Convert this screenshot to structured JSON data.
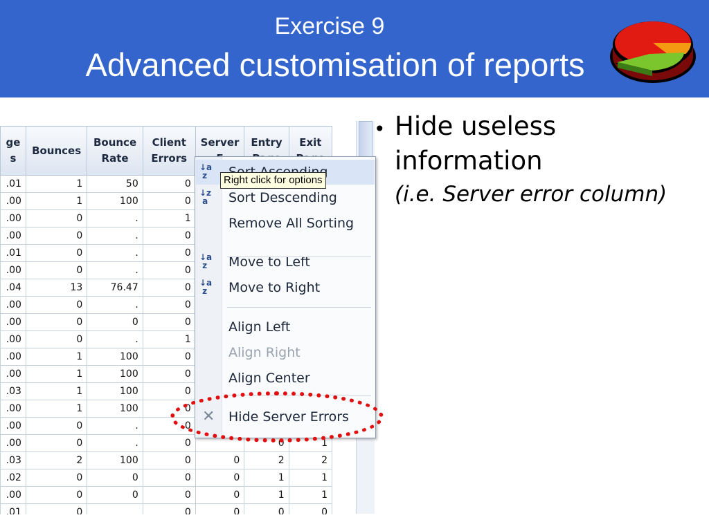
{
  "header": {
    "line1": "Exercise 9",
    "line2": "Advanced customisation of reports",
    "bg_color": "#3465cc",
    "logo_icon": "3d-pie-chart-icon"
  },
  "grid": {
    "columns": [
      {
        "label": "ge\ns"
      },
      {
        "label": "Bounces"
      },
      {
        "label": "Bounce\nRate"
      },
      {
        "label": "Client\nErrors"
      },
      {
        "label": "Server\nE"
      },
      {
        "label": "Entry\nPage"
      },
      {
        "label": "Exit\nPage"
      }
    ],
    "rows": [
      [
        ".01",
        "1",
        "50",
        "0",
        "",
        "",
        ""
      ],
      [
        ".00",
        "1",
        "100",
        "0",
        "",
        "",
        ""
      ],
      [
        ".00",
        "0",
        ".",
        "1",
        "",
        "",
        ""
      ],
      [
        ".00",
        "0",
        ".",
        "0",
        "",
        "",
        ""
      ],
      [
        ".01",
        "0",
        ".",
        "0",
        "",
        "",
        ""
      ],
      [
        ".00",
        "0",
        ".",
        "0",
        "",
        "",
        ""
      ],
      [
        ".04",
        "13",
        "76.47",
        "0",
        "",
        "",
        ""
      ],
      [
        ".00",
        "0",
        ".",
        "0",
        "",
        "",
        ""
      ],
      [
        ".00",
        "0",
        "0",
        "0",
        "",
        "",
        ""
      ],
      [
        ".00",
        "0",
        ".",
        "1",
        "",
        "",
        ""
      ],
      [
        ".00",
        "1",
        "100",
        "0",
        "",
        "",
        ""
      ],
      [
        ".00",
        "1",
        "100",
        "0",
        "",
        "",
        ""
      ],
      [
        ".03",
        "1",
        "100",
        "0",
        "",
        "",
        ""
      ],
      [
        ".00",
        "1",
        "100",
        "0",
        "",
        "",
        ""
      ],
      [
        ".00",
        "0",
        ".",
        "0",
        "",
        "",
        ""
      ],
      [
        ".00",
        "0",
        ".",
        "0",
        "",
        "0",
        "1"
      ],
      [
        ".03",
        "2",
        "100",
        "0",
        "0",
        "2",
        "2"
      ],
      [
        ".02",
        "0",
        "0",
        "0",
        "0",
        "1",
        "1"
      ],
      [
        ".00",
        "0",
        "0",
        "0",
        "0",
        "1",
        "1"
      ],
      [
        ".01",
        "0",
        "",
        "0",
        "0",
        "0",
        "0"
      ]
    ]
  },
  "context_menu": {
    "items": [
      {
        "label": "Sort Ascending",
        "icon": "sort-ascending-icon",
        "glyph": "↓a\n z",
        "highlighted": true,
        "disabled": false
      },
      {
        "label": "Sort Descending",
        "icon": "sort-descending-icon",
        "glyph": "↓z\n a",
        "highlighted": false,
        "disabled": false
      },
      {
        "label": "Remove All Sorting",
        "icon": "",
        "glyph": "",
        "highlighted": false,
        "disabled": false
      },
      {
        "label": "Move to Left",
        "icon": "move-left-icon",
        "glyph": "↓a\n z",
        "highlighted": false,
        "disabled": false
      },
      {
        "label": "Move to Right",
        "icon": "move-right-icon",
        "glyph": "↓a\n z",
        "highlighted": false,
        "disabled": false
      },
      {
        "label": "Align Left",
        "icon": "",
        "glyph": "",
        "highlighted": false,
        "disabled": false
      },
      {
        "label": "Align Right",
        "icon": "",
        "glyph": "",
        "highlighted": false,
        "disabled": true
      },
      {
        "label": "Align Center",
        "icon": "",
        "glyph": "",
        "highlighted": false,
        "disabled": false
      },
      {
        "label": "Hide Server Errors",
        "icon": "close-x-icon",
        "glyph": "✕",
        "highlighted": false,
        "disabled": false
      }
    ]
  },
  "tooltip": "Right click for options",
  "annotation_color": "#e11010",
  "bullet": {
    "main": "Hide useless information",
    "sub": "(i.e. Server error column)"
  }
}
